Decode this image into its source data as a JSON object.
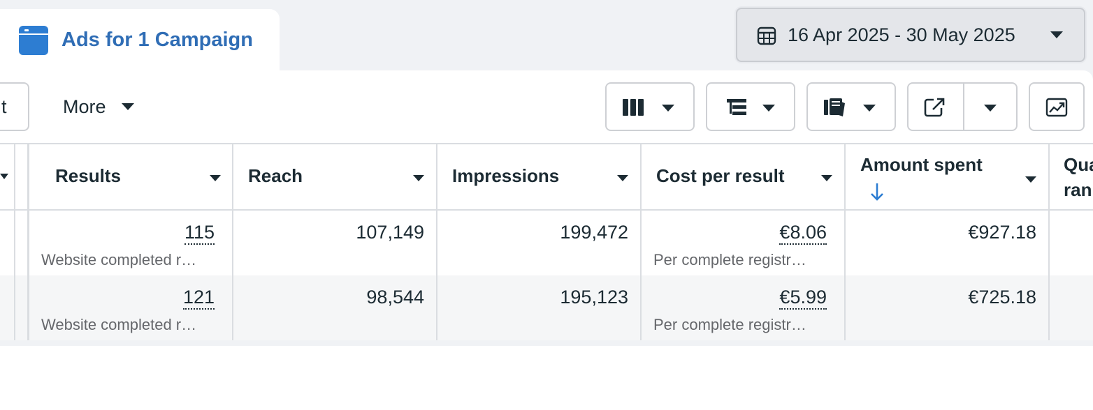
{
  "tab": {
    "label": "Ads for 1 Campaign"
  },
  "date_range": {
    "label": "16 Apr 2025 - 30 May 2025"
  },
  "toolbar": {
    "left_partial_label": "t",
    "more_label": "More",
    "buttons": [
      "columns-icon",
      "breakdown-icon",
      "reports-icon",
      "export-icon",
      "chart-icon"
    ]
  },
  "table": {
    "columns": [
      "Results",
      "Reach",
      "Impressions",
      "Cost per result",
      "Amount spent",
      "Qua ran"
    ],
    "column_partial": {
      "line1": "Qua",
      "line2": "ran"
    },
    "sorted_column": "Amount spent",
    "sort_direction": "descending",
    "rows": [
      {
        "results": "115",
        "results_sub": "Website completed r…",
        "reach": "107,149",
        "impressions": "199,472",
        "cost_per_result": "€8.06",
        "cost_sub": "Per complete registr…",
        "amount_spent": "€927.18"
      },
      {
        "results": "121",
        "results_sub": "Website completed r…",
        "reach": "98,544",
        "impressions": "195,123",
        "cost_per_result": "€5.99",
        "cost_sub": "Per complete registr…",
        "amount_spent": "€725.18"
      }
    ]
  },
  "colors": {
    "accent": "#2f6db5",
    "icon_blue": "#2d7dd2",
    "row_alt": "#f5f6f7",
    "text": "#1c2b33",
    "muted": "#65676b"
  }
}
